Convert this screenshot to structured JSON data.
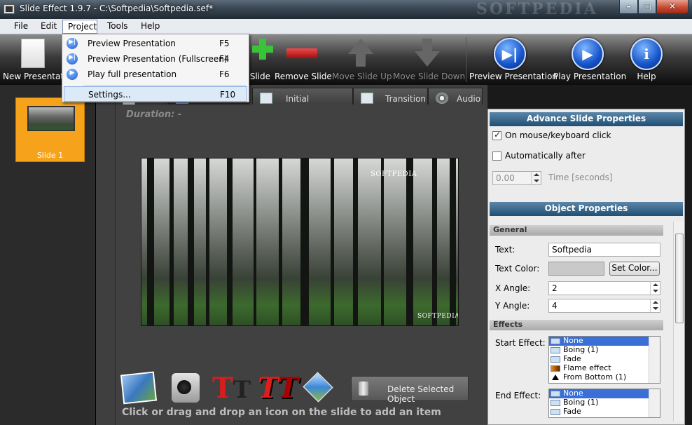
{
  "window": {
    "title": "Slide Effect 1.9.7 - C:\\Softpedia\\Softpedia.sef*",
    "watermark": "SOFTPEDIA",
    "controls": {
      "minimize": "–",
      "maximize": "□",
      "close": "✕"
    }
  },
  "menu": {
    "file": "File",
    "edit": "Edit",
    "project": "Project",
    "tools": "Tools",
    "help": "Help"
  },
  "toolbar": {
    "new_presentation": "New Presentat",
    "add_slide": "Slide",
    "remove_slide": "Remove Slide",
    "move_slide_up": "Move Slide Up",
    "move_slide_down": "Move Slide Down",
    "preview_presentation": "Preview Presentation",
    "play_presentation": "Play Presentation",
    "help": "Help"
  },
  "project_menu": {
    "items": [
      {
        "label": "Preview Presentation",
        "shortcut": "F5"
      },
      {
        "label": "Preview Presentation (Fullscreen)",
        "shortcut": "F4"
      },
      {
        "label": "Play full presentation",
        "shortcut": "F6"
      },
      {
        "label": "Settings...",
        "shortcut": "F10"
      }
    ]
  },
  "slides": {
    "items": [
      {
        "label": "Slide 1"
      }
    ]
  },
  "tabs": {
    "initial_transition": "Initial Transition",
    "transition": "Transition",
    "audio": "Audio"
  },
  "editor": {
    "duration": "Duration: -",
    "canvas_watermark_top": "SOFTPEDIA",
    "canvas_watermark_bottom": "SOFTPEDIA®",
    "delete_selected": "Delete Selected Object",
    "hint": "Click or drag and drop an icon on the slide to add an item",
    "text_icon_letter": "T"
  },
  "advance_props": {
    "title": "Advance Slide Properties",
    "on_click_label": "On mouse/keyboard click",
    "on_click_checked": true,
    "auto_after_label": "Automatically after",
    "auto_after_checked": false,
    "time_value": "0.00",
    "time_label": "Time [seconds]"
  },
  "object_props": {
    "title": "Object Properties",
    "general_header": "General",
    "text_label": "Text:",
    "text_value": "Softpedia",
    "text_color_label": "Text Color:",
    "set_color_label": "Set Color...",
    "x_angle_label": "X Angle:",
    "x_angle_value": "2",
    "y_angle_label": "Y Angle:",
    "y_angle_value": "4",
    "effects_header": "Effects",
    "start_effect_label": "Start Effect:",
    "start_effect_options": [
      "None",
      "Boing (1)",
      "Fade",
      "Flame effect",
      "From Bottom (1)"
    ],
    "end_effect_label": "End Effect:",
    "end_effect_options": [
      "None",
      "Boing (1)",
      "Fade"
    ]
  }
}
